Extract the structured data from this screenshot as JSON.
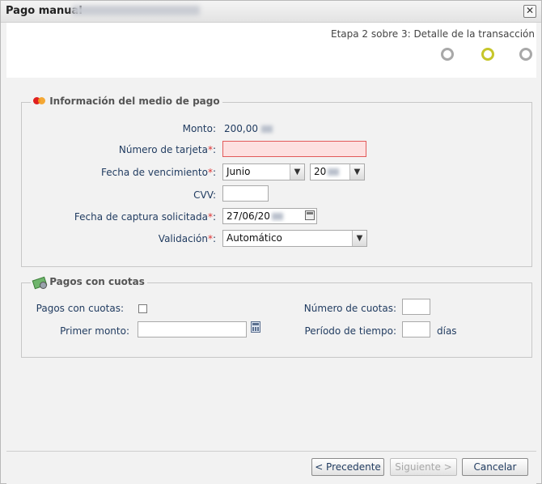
{
  "dialog": {
    "title": "Pago manual",
    "close_symbol": "✕"
  },
  "steps": {
    "label": "Etapa 2 sobre 3: Detalle de la transacción",
    "dots": [
      "inactive",
      "active",
      "inactive"
    ]
  },
  "payment_info": {
    "legend": "Información del medio de pago",
    "icon": "mastercard-icon",
    "amount_label": "Monto:",
    "amount_value": "200,00",
    "card_number_label": "Número de tarjeta",
    "card_number_value": "",
    "expiry_label": "Fecha de vencimiento",
    "expiry_month": "Junio",
    "expiry_year": "20",
    "cvv_label": "CVV:",
    "cvv_value": "",
    "capture_date_label": "Fecha de captura solicitada",
    "capture_date_value": "27/06/20",
    "validation_label": "Validación",
    "validation_value": "Automático",
    "required_mark": "*",
    "colon": ":"
  },
  "installments": {
    "legend": "Pagos con cuotas",
    "icon": "money-icon",
    "enabled_label": "Pagos con cuotas:",
    "first_amount_label": "Primer monto:",
    "first_amount_value": "",
    "count_label": "Número de cuotas:",
    "count_value": "",
    "period_label": "Período de tiempo:",
    "period_value": "",
    "period_unit": "días"
  },
  "footer": {
    "prev_label": "< Precedente",
    "next_label": "Siguiente >",
    "cancel_label": "Cancelar"
  },
  "colors": {
    "accent_step": "#c6c62a",
    "error_field_bg": "#fde0e0",
    "label_text": "#1f3a5f"
  }
}
